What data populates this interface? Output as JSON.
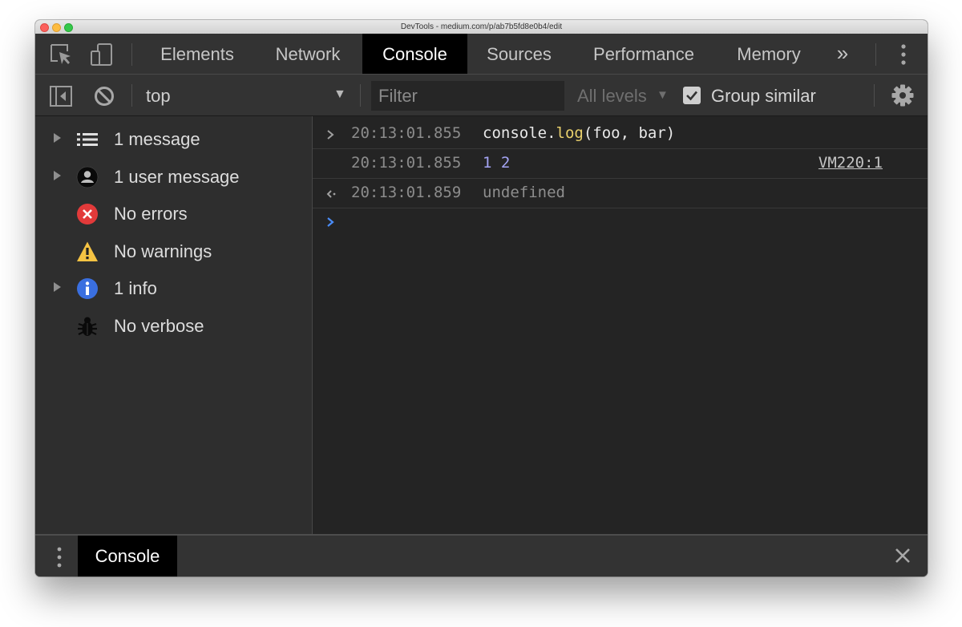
{
  "window": {
    "title": "DevTools - medium.com/p/ab7b5fd8e0b4/edit"
  },
  "toolbar": {
    "tabs": [
      {
        "label": "Elements",
        "active": false
      },
      {
        "label": "Network",
        "active": false
      },
      {
        "label": "Console",
        "active": true
      },
      {
        "label": "Sources",
        "active": false
      },
      {
        "label": "Performance",
        "active": false
      },
      {
        "label": "Memory",
        "active": false
      }
    ],
    "more_tabs_glyph": "»"
  },
  "console_toolbar": {
    "context": "top",
    "filter_placeholder": "Filter",
    "levels": "All levels",
    "group_similar": {
      "label": "Group similar",
      "checked": true
    }
  },
  "sidebar": {
    "items": [
      {
        "label": "1 message",
        "icon": "list-icon",
        "expandable": true
      },
      {
        "label": "1 user message",
        "icon": "user-icon",
        "expandable": true
      },
      {
        "label": "No errors",
        "icon": "error-icon",
        "expandable": false
      },
      {
        "label": "No warnings",
        "icon": "warning-icon",
        "expandable": false
      },
      {
        "label": "1 info",
        "icon": "info-icon",
        "expandable": true
      },
      {
        "label": "No verbose",
        "icon": "bug-icon",
        "expandable": false
      }
    ]
  },
  "console": {
    "entries": [
      {
        "kind": "input",
        "timestamp": "20:13:01.855",
        "code": {
          "obj": "console.",
          "fn": "log",
          "args": "(foo, bar)"
        }
      },
      {
        "kind": "log",
        "timestamp": "20:13:01.855",
        "values": "1 2",
        "source": "VM220:1"
      },
      {
        "kind": "result",
        "timestamp": "20:13:01.859",
        "value": "undefined"
      }
    ]
  },
  "drawer": {
    "tab": "Console"
  },
  "colors": {
    "panel": "#333333",
    "console_bg": "#242424",
    "active_tab": "#000000",
    "number": "#a4a4f4",
    "function": "#e9d06c",
    "prompt": "#4a8cf7",
    "error": "#e23a3a",
    "warning": "#f5c343",
    "info": "#3a6fe0"
  }
}
